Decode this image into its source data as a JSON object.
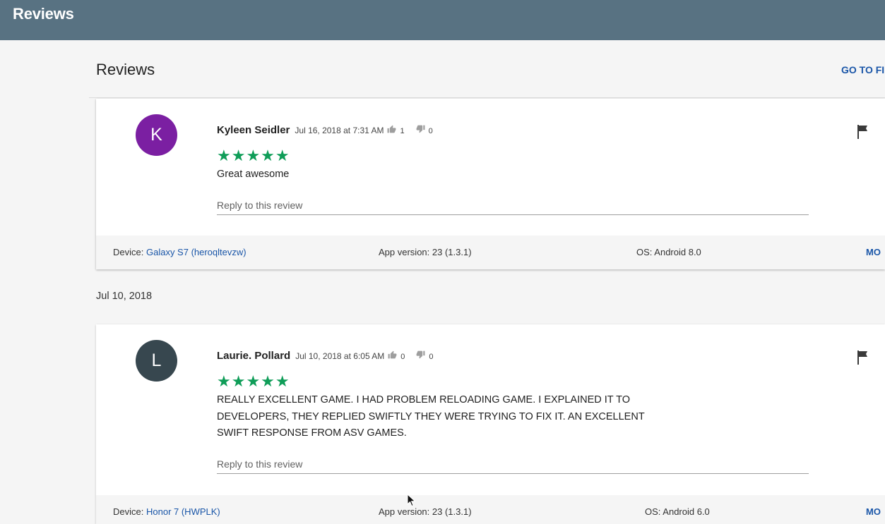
{
  "app_bar": {
    "title": "Reviews"
  },
  "section": {
    "title": "Reviews",
    "go_to_link": "GO TO FI"
  },
  "colors": {
    "app_bar": "#587282",
    "link": "#1a56a8",
    "star": "#0f9d58",
    "avatar_k": "#7b1fa2",
    "avatar_l": "#37474f"
  },
  "reviews": [
    {
      "avatar_letter": "K",
      "author": "Kyleen Seidler",
      "time": "Jul 16, 2018 at 7:31 AM",
      "thumbs_up": "1",
      "thumbs_down": "0",
      "rating": 5,
      "stars": "★★★★★",
      "text": "Great awesome",
      "reply_placeholder": "Reply to this review",
      "device_label": "Device:",
      "device_value": "Galaxy S7 (heroqltevzw)",
      "app_version": "App version: 23 (1.3.1)",
      "os": "OS: Android 8.0",
      "more": "MO"
    },
    {
      "avatar_letter": "L",
      "author": "Laurie. Pollard",
      "time": "Jul 10, 2018 at 6:05 AM",
      "thumbs_up": "0",
      "thumbs_down": "0",
      "rating": 5,
      "stars": "★★★★★",
      "text_lines": [
        "REALLY EXCELLENT GAME. I HAD PROBLEM RELOADING GAME. I EXPLAINED IT TO",
        "DEVELOPERS, THEY REPLIED SWIFTLY THEY WERE TRYING TO FIX IT. AN EXCELLENT",
        "SWIFT RESPONSE FROM ASV GAMES."
      ],
      "reply_placeholder": "Reply to this review",
      "device_label": "Device:",
      "device_value": "Honor 7 (HWPLK)",
      "app_version": "App version: 23 (1.3.1)",
      "os": "OS: Android 6.0",
      "more": "MO"
    }
  ],
  "date_divider": "Jul 10, 2018",
  "icons": {
    "flag": "flag-icon",
    "thumb_up": "thumb-up-icon",
    "thumb_down": "thumb-down-icon",
    "cursor": "mouse-cursor-icon"
  }
}
